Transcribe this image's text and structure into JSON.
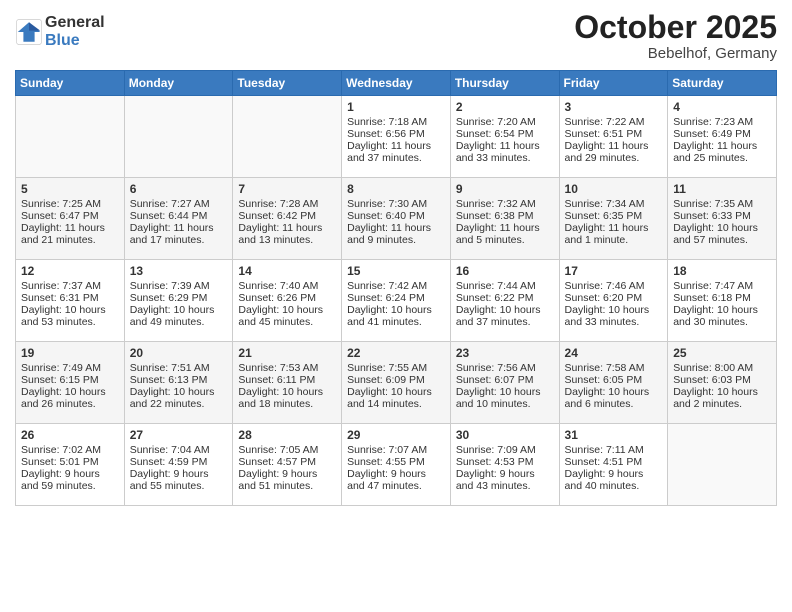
{
  "header": {
    "logo_general": "General",
    "logo_blue": "Blue",
    "month_title": "October 2025",
    "location": "Bebelhof, Germany"
  },
  "days_of_week": [
    "Sunday",
    "Monday",
    "Tuesday",
    "Wednesday",
    "Thursday",
    "Friday",
    "Saturday"
  ],
  "weeks": [
    [
      {
        "day": "",
        "info": ""
      },
      {
        "day": "",
        "info": ""
      },
      {
        "day": "",
        "info": ""
      },
      {
        "day": "1",
        "info": "Sunrise: 7:18 AM\nSunset: 6:56 PM\nDaylight: 11 hours\nand 37 minutes."
      },
      {
        "day": "2",
        "info": "Sunrise: 7:20 AM\nSunset: 6:54 PM\nDaylight: 11 hours\nand 33 minutes."
      },
      {
        "day": "3",
        "info": "Sunrise: 7:22 AM\nSunset: 6:51 PM\nDaylight: 11 hours\nand 29 minutes."
      },
      {
        "day": "4",
        "info": "Sunrise: 7:23 AM\nSunset: 6:49 PM\nDaylight: 11 hours\nand 25 minutes."
      }
    ],
    [
      {
        "day": "5",
        "info": "Sunrise: 7:25 AM\nSunset: 6:47 PM\nDaylight: 11 hours\nand 21 minutes."
      },
      {
        "day": "6",
        "info": "Sunrise: 7:27 AM\nSunset: 6:44 PM\nDaylight: 11 hours\nand 17 minutes."
      },
      {
        "day": "7",
        "info": "Sunrise: 7:28 AM\nSunset: 6:42 PM\nDaylight: 11 hours\nand 13 minutes."
      },
      {
        "day": "8",
        "info": "Sunrise: 7:30 AM\nSunset: 6:40 PM\nDaylight: 11 hours\nand 9 minutes."
      },
      {
        "day": "9",
        "info": "Sunrise: 7:32 AM\nSunset: 6:38 PM\nDaylight: 11 hours\nand 5 minutes."
      },
      {
        "day": "10",
        "info": "Sunrise: 7:34 AM\nSunset: 6:35 PM\nDaylight: 11 hours\nand 1 minute."
      },
      {
        "day": "11",
        "info": "Sunrise: 7:35 AM\nSunset: 6:33 PM\nDaylight: 10 hours\nand 57 minutes."
      }
    ],
    [
      {
        "day": "12",
        "info": "Sunrise: 7:37 AM\nSunset: 6:31 PM\nDaylight: 10 hours\nand 53 minutes."
      },
      {
        "day": "13",
        "info": "Sunrise: 7:39 AM\nSunset: 6:29 PM\nDaylight: 10 hours\nand 49 minutes."
      },
      {
        "day": "14",
        "info": "Sunrise: 7:40 AM\nSunset: 6:26 PM\nDaylight: 10 hours\nand 45 minutes."
      },
      {
        "day": "15",
        "info": "Sunrise: 7:42 AM\nSunset: 6:24 PM\nDaylight: 10 hours\nand 41 minutes."
      },
      {
        "day": "16",
        "info": "Sunrise: 7:44 AM\nSunset: 6:22 PM\nDaylight: 10 hours\nand 37 minutes."
      },
      {
        "day": "17",
        "info": "Sunrise: 7:46 AM\nSunset: 6:20 PM\nDaylight: 10 hours\nand 33 minutes."
      },
      {
        "day": "18",
        "info": "Sunrise: 7:47 AM\nSunset: 6:18 PM\nDaylight: 10 hours\nand 30 minutes."
      }
    ],
    [
      {
        "day": "19",
        "info": "Sunrise: 7:49 AM\nSunset: 6:15 PM\nDaylight: 10 hours\nand 26 minutes."
      },
      {
        "day": "20",
        "info": "Sunrise: 7:51 AM\nSunset: 6:13 PM\nDaylight: 10 hours\nand 22 minutes."
      },
      {
        "day": "21",
        "info": "Sunrise: 7:53 AM\nSunset: 6:11 PM\nDaylight: 10 hours\nand 18 minutes."
      },
      {
        "day": "22",
        "info": "Sunrise: 7:55 AM\nSunset: 6:09 PM\nDaylight: 10 hours\nand 14 minutes."
      },
      {
        "day": "23",
        "info": "Sunrise: 7:56 AM\nSunset: 6:07 PM\nDaylight: 10 hours\nand 10 minutes."
      },
      {
        "day": "24",
        "info": "Sunrise: 7:58 AM\nSunset: 6:05 PM\nDaylight: 10 hours\nand 6 minutes."
      },
      {
        "day": "25",
        "info": "Sunrise: 8:00 AM\nSunset: 6:03 PM\nDaylight: 10 hours\nand 2 minutes."
      }
    ],
    [
      {
        "day": "26",
        "info": "Sunrise: 7:02 AM\nSunset: 5:01 PM\nDaylight: 9 hours\nand 59 minutes."
      },
      {
        "day": "27",
        "info": "Sunrise: 7:04 AM\nSunset: 4:59 PM\nDaylight: 9 hours\nand 55 minutes."
      },
      {
        "day": "28",
        "info": "Sunrise: 7:05 AM\nSunset: 4:57 PM\nDaylight: 9 hours\nand 51 minutes."
      },
      {
        "day": "29",
        "info": "Sunrise: 7:07 AM\nSunset: 4:55 PM\nDaylight: 9 hours\nand 47 minutes."
      },
      {
        "day": "30",
        "info": "Sunrise: 7:09 AM\nSunset: 4:53 PM\nDaylight: 9 hours\nand 43 minutes."
      },
      {
        "day": "31",
        "info": "Sunrise: 7:11 AM\nSunset: 4:51 PM\nDaylight: 9 hours\nand 40 minutes."
      },
      {
        "day": "",
        "info": ""
      }
    ]
  ]
}
